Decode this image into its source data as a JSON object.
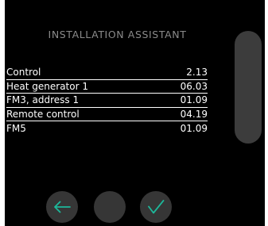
{
  "title": "INSTALLATION ASSISTANT",
  "versions": [
    {
      "label": "Control",
      "value": "2.13"
    },
    {
      "label": "Heat generator 1",
      "value": "06.03"
    },
    {
      "label": "FM3, address 1",
      "value": "01.09"
    },
    {
      "label": "Remote control",
      "value": "04.19"
    },
    {
      "label": "FM5",
      "value": "01.09"
    }
  ],
  "buttons": {
    "back_icon": "arrow-left-icon",
    "confirm_icon": "checkmark-icon"
  },
  "colors": {
    "background": "#000000",
    "accent": "#1db89a",
    "title": "#8a8a8a",
    "button": "#363636",
    "scrollbar": "#3c3c3c"
  }
}
